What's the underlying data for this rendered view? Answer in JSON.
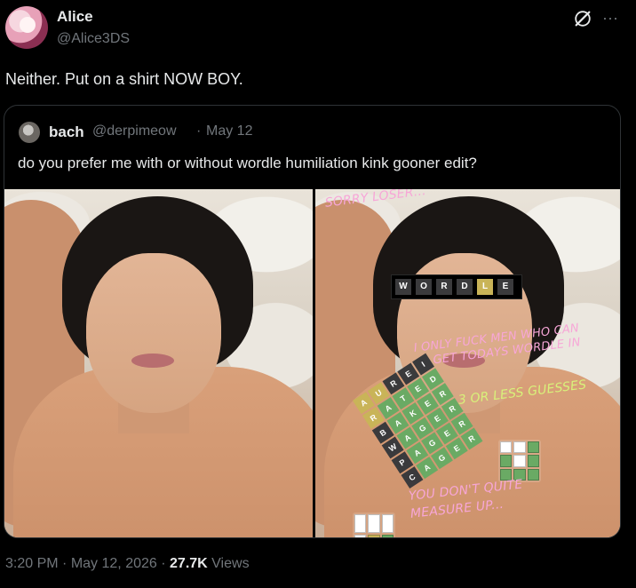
{
  "header": {
    "display_name": "Alice",
    "handle": "@Alice3DS",
    "more_symbol": "···"
  },
  "tweet": {
    "text": "Neither. Put on a shirt NOW BOY."
  },
  "quote": {
    "display_name": "bach",
    "handle": "@derpimeow",
    "separator": "·",
    "date": "May 12",
    "text": "do you prefer me with or without wordle humiliation kink gooner edit?"
  },
  "overlay": {
    "top_caption": "SORRY LOSER...",
    "censor_letters": [
      "W",
      "O",
      "R",
      "D",
      "L",
      "E"
    ],
    "caption_1_line_1": "I ONLY FUCK MEN WHO CAN",
    "caption_1_line_2": "GET TODAYS WORDLE IN",
    "caption_2": "3 OR LESS GUESSES",
    "caption_3_line_1": "YOU DON'T QUITE",
    "caption_3_line_2": "MEASURE UP...",
    "grid_words": [
      "AUREI",
      "RATED",
      "BAKER",
      "WAGER",
      "PAGER",
      "CAGER"
    ]
  },
  "footer": {
    "time": "3:20 PM",
    "separator": "·",
    "date": "May 12, 2026",
    "views_count": "27.7K",
    "views_label": "Views"
  },
  "colors": {
    "background": "#000000",
    "text_primary": "#e7e9ea",
    "text_secondary": "#71767b",
    "border": "#2f3336",
    "wordle_green": "#6aaa64",
    "wordle_yellow": "#c9b458",
    "wordle_gray": "#3a3a3c",
    "overlay_pink": "#f7a6d7",
    "overlay_green": "#d8f27a"
  },
  "icons": {
    "grok": "grok-icon",
    "more": "more-icon"
  }
}
